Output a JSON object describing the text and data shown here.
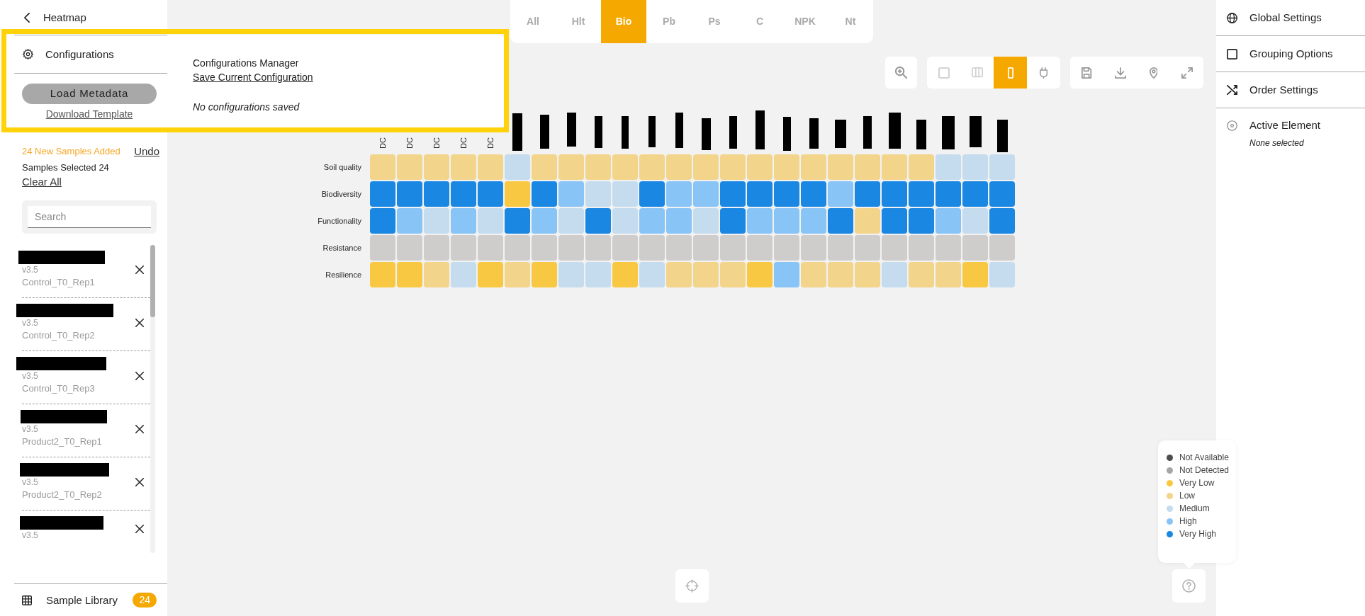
{
  "left_sidebar": {
    "title": "Heatmap",
    "configurations": "Configurations",
    "load_button": "Load Metadata",
    "template_link": "Download Template",
    "added_notice": "24 New Samples Added",
    "undo_link": "Undo",
    "selected_count": "Samples Selected 24",
    "clear_link": "Clear All",
    "search": {
      "placeholder": "Search"
    },
    "samples": [
      {
        "version": "v3.5",
        "name": "Control_T0_Rep1"
      },
      {
        "version": "v3.5",
        "name": "Control_T0_Rep2"
      },
      {
        "version": "v3.5",
        "name": "Control_T0_Rep3"
      },
      {
        "version": "v3.5",
        "name": "Product2_T0_Rep1"
      },
      {
        "version": "v3.5",
        "name": "Product2_T0_Rep2"
      },
      {
        "version": "v3.5"
      }
    ],
    "footer": {
      "label": "Sample Library",
      "badge": "24"
    }
  },
  "config_popup": {
    "title": "Configurations Manager",
    "save_link": "Save Current Configuration",
    "empty_text": "No configurations saved"
  },
  "tabs": [
    {
      "label": "All",
      "selected": false
    },
    {
      "label": "Hlt",
      "selected": false
    },
    {
      "label": "Bio",
      "selected": true
    },
    {
      "label": "Pb",
      "selected": false
    },
    {
      "label": "Ps",
      "selected": false
    },
    {
      "label": "C",
      "selected": false
    },
    {
      "label": "NPK",
      "selected": false
    },
    {
      "label": "Nt",
      "selected": false
    }
  ],
  "view_modes": [
    {
      "selected": false,
      "disabled": true
    },
    {
      "selected": false,
      "disabled": true
    },
    {
      "selected": true,
      "disabled": false
    },
    {
      "selected": false,
      "disabled": false
    }
  ],
  "heatmap": {
    "columns": [
      {
        "label": "DC",
        "redacted": false
      },
      {
        "label": "DC",
        "redacted": false
      },
      {
        "label": "DC",
        "redacted": false
      },
      {
        "label": "DC",
        "redacted": false
      },
      {
        "label": "DC",
        "redacted": false
      },
      {
        "redacted": true
      },
      {
        "redacted": true
      },
      {
        "redacted": true
      },
      {
        "redacted": true
      },
      {
        "redacted": true
      },
      {
        "redacted": true
      },
      {
        "redacted": true
      },
      {
        "redacted": true
      },
      {
        "redacted": true
      },
      {
        "redacted": true
      },
      {
        "redacted": true
      },
      {
        "redacted": true
      },
      {
        "redacted": true
      },
      {
        "redacted": true
      },
      {
        "redacted": true
      },
      {
        "redacted": true
      },
      {
        "redacted": true
      },
      {
        "redacted": true
      },
      {
        "redacted": true
      }
    ],
    "rows": [
      {
        "label": "Soil quality",
        "cells": [
          {
            "color": "#f3d48b"
          },
          {
            "color": "#f3d48b"
          },
          {
            "color": "#f3d48b"
          },
          {
            "color": "#f3d48b"
          },
          {
            "color": "#f3d48b"
          },
          {
            "color": "#c5dcef"
          },
          {
            "color": "#f3d48b"
          },
          {
            "color": "#f3d48b"
          },
          {
            "color": "#f3d48b"
          },
          {
            "color": "#f3d48b"
          },
          {
            "color": "#f3d48b"
          },
          {
            "color": "#f3d48b"
          },
          {
            "color": "#f3d48b"
          },
          {
            "color": "#f3d48b"
          },
          {
            "color": "#f3d48b"
          },
          {
            "color": "#f3d48b"
          },
          {
            "color": "#f3d48b"
          },
          {
            "color": "#f3d48b"
          },
          {
            "color": "#f3d48b"
          },
          {
            "color": "#f3d48b"
          },
          {
            "color": "#f3d48b"
          },
          {
            "color": "#c5dcef"
          },
          {
            "color": "#c5dcef"
          },
          {
            "color": "#c5dcef"
          }
        ]
      },
      {
        "label": "Biodiversity",
        "cells": [
          {
            "color": "#1a87e3"
          },
          {
            "color": "#1a87e3"
          },
          {
            "color": "#1a87e3"
          },
          {
            "color": "#1a87e3"
          },
          {
            "color": "#1a87e3"
          },
          {
            "color": "#f9c843"
          },
          {
            "color": "#1a87e3"
          },
          {
            "color": "#89c4f7"
          },
          {
            "color": "#c5dcef"
          },
          {
            "color": "#c5dcef"
          },
          {
            "color": "#1a87e3"
          },
          {
            "color": "#89c4f7"
          },
          {
            "color": "#89c4f7"
          },
          {
            "color": "#1a87e3"
          },
          {
            "color": "#1a87e3"
          },
          {
            "color": "#1a87e3"
          },
          {
            "color": "#1a87e3"
          },
          {
            "color": "#89c4f7"
          },
          {
            "color": "#1a87e3"
          },
          {
            "color": "#1a87e3"
          },
          {
            "color": "#1a87e3"
          },
          {
            "color": "#1a87e3"
          },
          {
            "color": "#1a87e3"
          },
          {
            "color": "#1a87e3"
          }
        ]
      },
      {
        "label": "Functionality",
        "cells": [
          {
            "color": "#1a87e3"
          },
          {
            "color": "#89c4f7"
          },
          {
            "color": "#c5dcef"
          },
          {
            "color": "#89c4f7"
          },
          {
            "color": "#c5dcef"
          },
          {
            "color": "#1a87e3"
          },
          {
            "color": "#89c4f7"
          },
          {
            "color": "#c5dcef"
          },
          {
            "color": "#1a87e3"
          },
          {
            "color": "#c5dcef"
          },
          {
            "color": "#89c4f7"
          },
          {
            "color": "#89c4f7"
          },
          {
            "color": "#c5dcef"
          },
          {
            "color": "#1a87e3"
          },
          {
            "color": "#89c4f7"
          },
          {
            "color": "#89c4f7"
          },
          {
            "color": "#89c4f7"
          },
          {
            "color": "#1a87e3"
          },
          {
            "color": "#f3d48b"
          },
          {
            "color": "#1a87e3"
          },
          {
            "color": "#1a87e3"
          },
          {
            "color": "#89c4f7"
          },
          {
            "color": "#c5dcef"
          },
          {
            "color": "#1a87e3"
          }
        ]
      },
      {
        "label": "Resistance",
        "cells": [
          {
            "color": "#cecdcc"
          },
          {
            "color": "#cecdcc"
          },
          {
            "color": "#cecdcc"
          },
          {
            "color": "#cecdcc"
          },
          {
            "color": "#cecdcc"
          },
          {
            "color": "#cecdcc"
          },
          {
            "color": "#cecdcc"
          },
          {
            "color": "#cecdcc"
          },
          {
            "color": "#cecdcc"
          },
          {
            "color": "#cecdcc"
          },
          {
            "color": "#cecdcc"
          },
          {
            "color": "#cecdcc"
          },
          {
            "color": "#cecdcc"
          },
          {
            "color": "#cecdcc"
          },
          {
            "color": "#cecdcc"
          },
          {
            "color": "#cecdcc"
          },
          {
            "color": "#cecdcc"
          },
          {
            "color": "#cecdcc"
          },
          {
            "color": "#cecdcc"
          },
          {
            "color": "#cecdcc"
          },
          {
            "color": "#cecdcc"
          },
          {
            "color": "#cecdcc"
          },
          {
            "color": "#cecdcc"
          },
          {
            "color": "#cecdcc"
          }
        ]
      },
      {
        "label": "Resilience",
        "cells": [
          {
            "color": "#f9c843"
          },
          {
            "color": "#f9c843"
          },
          {
            "color": "#f3d48b"
          },
          {
            "color": "#c5dcef"
          },
          {
            "color": "#f9c843"
          },
          {
            "color": "#f3d48b"
          },
          {
            "color": "#f9c843"
          },
          {
            "color": "#c5dcef"
          },
          {
            "color": "#c5dcef"
          },
          {
            "color": "#f9c843"
          },
          {
            "color": "#c5dcef"
          },
          {
            "color": "#f3d48b"
          },
          {
            "color": "#f3d48b"
          },
          {
            "color": "#f3d48b"
          },
          {
            "color": "#f9c843"
          },
          {
            "color": "#89c4f7"
          },
          {
            "color": "#f3d48b"
          },
          {
            "color": "#f3d48b"
          },
          {
            "color": "#f3d48b"
          },
          {
            "color": "#c5dcef"
          },
          {
            "color": "#f3d48b"
          },
          {
            "color": "#f3d48b"
          },
          {
            "color": "#f9c843"
          },
          {
            "color": "#c5dcef"
          }
        ]
      }
    ]
  },
  "legend": {
    "items": [
      {
        "label": "Not Available",
        "color": "#4d4d4d"
      },
      {
        "label": "Not Detected",
        "color": "#a6a6a6"
      },
      {
        "label": "Very Low",
        "color": "#f9c843"
      },
      {
        "label": "Low",
        "color": "#f3d48b"
      },
      {
        "label": "Medium",
        "color": "#c5dcef"
      },
      {
        "label": "High",
        "color": "#89c4f7"
      },
      {
        "label": "Very High",
        "color": "#1a87e3"
      }
    ]
  },
  "right_sidebar": {
    "items": [
      {
        "label": "Global Settings"
      },
      {
        "label": "Grouping Options"
      },
      {
        "label": "Order Settings"
      },
      {
        "label": "Active Element",
        "subtitle": "None selected"
      }
    ]
  }
}
